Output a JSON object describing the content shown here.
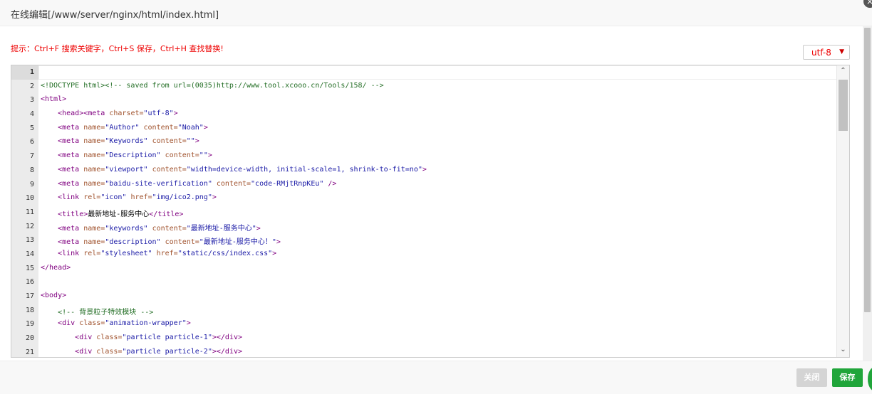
{
  "window": {
    "title": "在线编辑[/www/server/nginx/html/index.html]",
    "close_glyph": "×"
  },
  "hint": "提示：Ctrl+F 搜索关键字，Ctrl+S 保存，Ctrl+H 查找替换!",
  "encoding": {
    "selected": "utf-8",
    "arrow_icon": "chevron-down-icon"
  },
  "editor": {
    "lines": [
      {
        "num": "1"
      },
      {
        "num": "2"
      },
      {
        "num": "3"
      },
      {
        "num": "4"
      },
      {
        "num": "5"
      },
      {
        "num": "6"
      },
      {
        "num": "7"
      },
      {
        "num": "8"
      },
      {
        "num": "9"
      },
      {
        "num": "10"
      },
      {
        "num": "11"
      },
      {
        "num": "12"
      },
      {
        "num": "13"
      },
      {
        "num": "14"
      },
      {
        "num": "15"
      },
      {
        "num": "16"
      },
      {
        "num": "17"
      },
      {
        "num": "18"
      },
      {
        "num": "19"
      },
      {
        "num": "20"
      },
      {
        "num": "21"
      }
    ],
    "code": {
      "l2": "<!DOCTYPE html><!-- saved from url=(0035)http://www.tool.xcooo.cn/Tools/158/ -->",
      "l3": "<html>",
      "l4_a": "<head>",
      "l4_b": "<meta",
      "l4_c": " charset=",
      "l4_d": "\"utf-8\"",
      "l4_e": ">",
      "l5_a": "<meta",
      "l5_b": " name=",
      "l5_c": "\"Author\"",
      "l5_d": " content=",
      "l5_e": "\"Noah\"",
      "l5_f": ">",
      "l6_a": "<meta",
      "l6_b": " name=",
      "l6_c": "\"Keywords\"",
      "l6_d": " content=",
      "l6_e": "\"\"",
      "l6_f": ">",
      "l7_a": "<meta",
      "l7_b": " name=",
      "l7_c": "\"Description\"",
      "l7_d": " content=",
      "l7_e": "\"\"",
      "l7_f": ">",
      "l8_a": "<meta",
      "l8_b": " name=",
      "l8_c": "\"viewport\"",
      "l8_d": " content=",
      "l8_e": "\"width=device-width, initial-scale=1, shrink-to-fit=no\"",
      "l8_f": ">",
      "l9_a": "<meta",
      "l9_b": " name=",
      "l9_c": "\"baidu-site-verification\"",
      "l9_d": " content=",
      "l9_e": "\"code-RMjtRnpKEu\"",
      "l9_f": " />",
      "l10_a": "<link",
      "l10_b": " rel=",
      "l10_c": "\"icon\"",
      "l10_d": " href=",
      "l10_e": "\"img/ico2.png\"",
      "l10_f": ">",
      "l11_a": "<title>",
      "l11_b": "最新地址-服务中心",
      "l11_c": "</title>",
      "l12_a": "<meta",
      "l12_b": " name=",
      "l12_c": "\"keywords\"",
      "l12_d": " content=",
      "l12_e": "\"最新地址-服务中心\"",
      "l12_f": ">",
      "l13_a": "<meta",
      "l13_b": " name=",
      "l13_c": "\"description\"",
      "l13_d": " content=",
      "l13_e": "\"最新地址-服务中心！\"",
      "l13_f": ">",
      "l14_a": "<link",
      "l14_b": " rel=",
      "l14_c": "\"stylesheet\"",
      "l14_d": " href=",
      "l14_e": "\"static/css/index.css\"",
      "l14_f": ">",
      "l15": "</head>",
      "l17": "<body>",
      "l18": "<!-- 背景粒子特效模块 -->",
      "l19_a": "<div",
      "l19_b": " class=",
      "l19_c": "\"animation-wrapper\"",
      "l19_d": ">",
      "l20_a": "<div",
      "l20_b": " class=",
      "l20_c": "\"particle particle-1\"",
      "l20_d": "></div>",
      "l21_a": "<div",
      "l21_b": " class=",
      "l21_c": "\"particle particle-2\"",
      "l21_d": "></div>"
    }
  },
  "scrollbar": {
    "up_glyph": "⌃",
    "down_glyph": "⌄"
  },
  "footer": {
    "close_label": "关闭",
    "save_label": "保存"
  }
}
